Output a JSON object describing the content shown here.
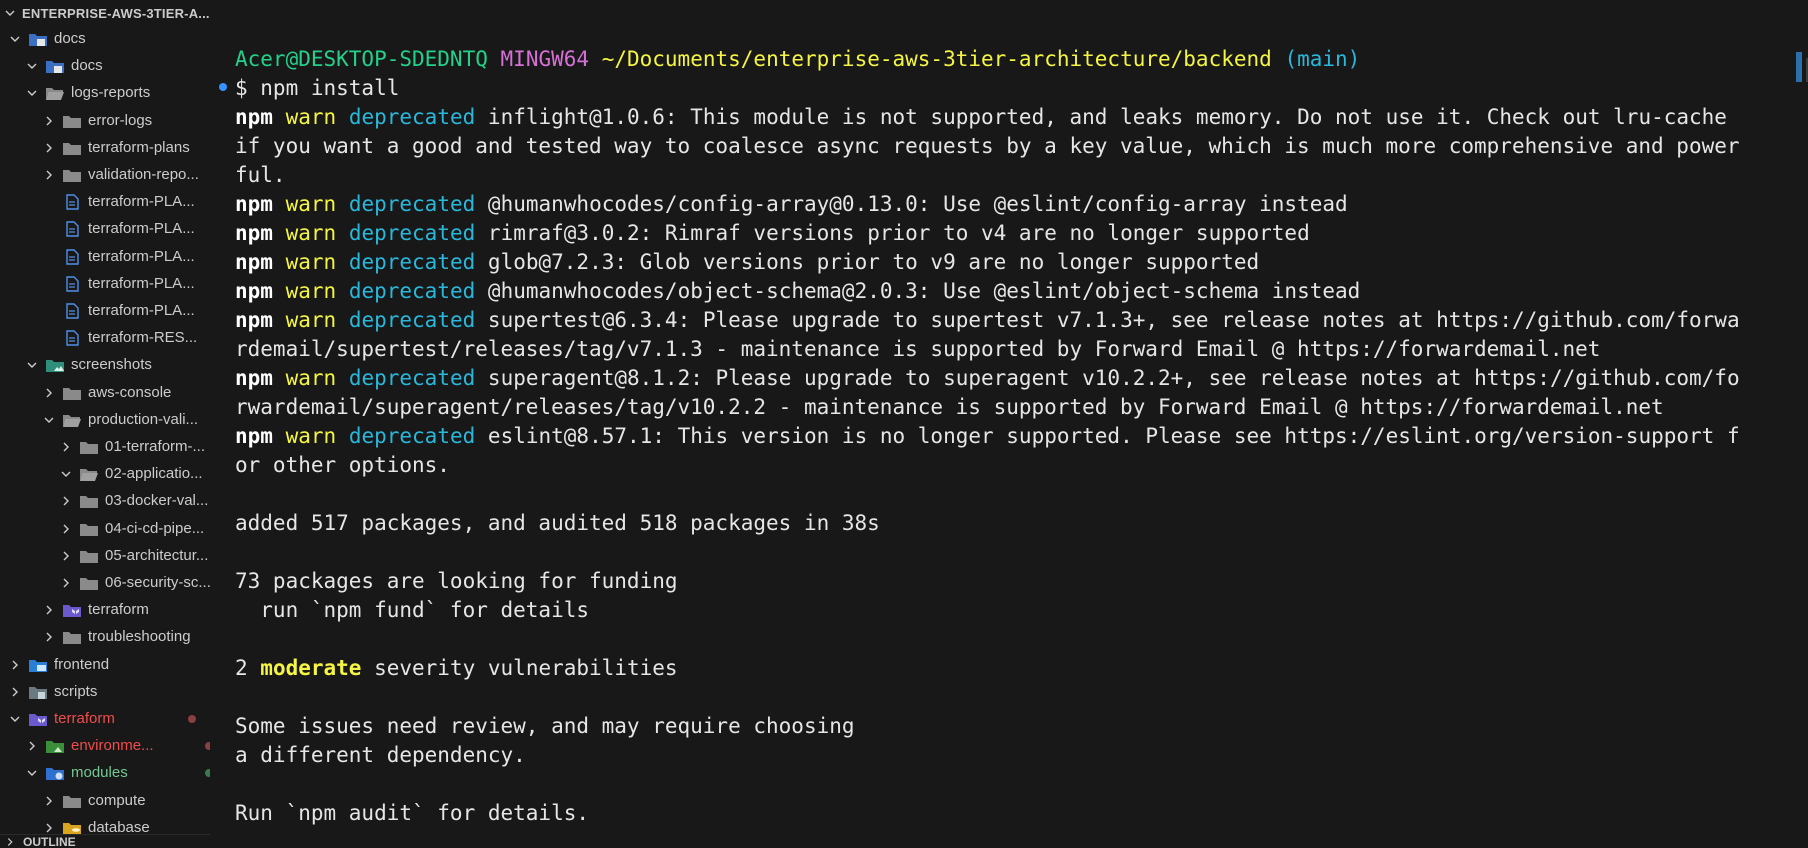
{
  "explorer": {
    "root_title": "ENTERPRISE-AWS-3TIER-A...",
    "outline_label": "OUTLINE",
    "items": [
      {
        "label": "docs",
        "depth": 1,
        "expanded": true,
        "icon": "docs-folder-icon",
        "color": "#cccccc"
      },
      {
        "label": "docs",
        "depth": 2,
        "expanded": true,
        "icon": "docs-folder-icon",
        "color": "#cccccc"
      },
      {
        "label": "logs-reports",
        "depth": 2,
        "expanded": true,
        "icon": "folder-open-icon",
        "color": "#cccccc"
      },
      {
        "label": "error-logs",
        "depth": 3,
        "expanded": false,
        "icon": "folder-icon",
        "color": "#cccccc"
      },
      {
        "label": "terraform-plans",
        "depth": 3,
        "expanded": false,
        "icon": "folder-icon",
        "color": "#cccccc"
      },
      {
        "label": "validation-repo...",
        "depth": 3,
        "expanded": false,
        "icon": "folder-icon",
        "color": "#cccccc"
      },
      {
        "label": "terraform-PLA...",
        "depth": 3,
        "file": true,
        "icon": "file-icon",
        "color": "#cccccc"
      },
      {
        "label": "terraform-PLA...",
        "depth": 3,
        "file": true,
        "icon": "file-icon",
        "color": "#cccccc"
      },
      {
        "label": "terraform-PLA...",
        "depth": 3,
        "file": true,
        "icon": "file-icon",
        "color": "#cccccc"
      },
      {
        "label": "terraform-PLA...",
        "depth": 3,
        "file": true,
        "icon": "file-icon",
        "color": "#cccccc"
      },
      {
        "label": "terraform-PLA...",
        "depth": 3,
        "file": true,
        "icon": "file-icon",
        "color": "#cccccc"
      },
      {
        "label": "terraform-RES...",
        "depth": 3,
        "file": true,
        "icon": "file-icon",
        "color": "#cccccc"
      },
      {
        "label": "screenshots",
        "depth": 2,
        "expanded": true,
        "icon": "images-folder-icon",
        "color": "#cccccc"
      },
      {
        "label": "aws-console",
        "depth": 3,
        "expanded": false,
        "icon": "folder-icon",
        "color": "#cccccc"
      },
      {
        "label": "production-vali...",
        "depth": 3,
        "expanded": true,
        "icon": "folder-open-icon",
        "color": "#cccccc"
      },
      {
        "label": "01-terraform-...",
        "depth": 4,
        "expanded": false,
        "icon": "folder-icon",
        "color": "#cccccc"
      },
      {
        "label": "02-applicatio...",
        "depth": 4,
        "expanded": true,
        "icon": "folder-open-icon",
        "color": "#cccccc"
      },
      {
        "label": "03-docker-val...",
        "depth": 4,
        "expanded": false,
        "icon": "folder-icon",
        "color": "#cccccc"
      },
      {
        "label": "04-ci-cd-pipe...",
        "depth": 4,
        "expanded": false,
        "icon": "folder-icon",
        "color": "#cccccc"
      },
      {
        "label": "05-architectur...",
        "depth": 4,
        "expanded": false,
        "icon": "folder-icon",
        "color": "#cccccc"
      },
      {
        "label": "06-security-sc...",
        "depth": 4,
        "expanded": false,
        "icon": "folder-icon",
        "color": "#cccccc"
      },
      {
        "label": "terraform",
        "depth": 3,
        "expanded": false,
        "icon": "terraform-folder-icon",
        "color": "#cccccc"
      },
      {
        "label": "troubleshooting",
        "depth": 3,
        "expanded": false,
        "icon": "folder-icon",
        "color": "#cccccc"
      },
      {
        "label": "frontend",
        "depth": 1,
        "expanded": false,
        "icon": "frontend-folder-icon",
        "color": "#cccccc"
      },
      {
        "label": "scripts",
        "depth": 1,
        "expanded": false,
        "icon": "scripts-folder-icon",
        "color": "#cccccc"
      },
      {
        "label": "terraform",
        "depth": 1,
        "expanded": true,
        "icon": "terraform-folder-icon",
        "color": "#f14c4c",
        "dot": "#8a4040"
      },
      {
        "label": "environme...",
        "depth": 2,
        "expanded": false,
        "icon": "environment-folder-icon",
        "color": "#f14c4c",
        "dot": "#8a4040"
      },
      {
        "label": "modules",
        "depth": 2,
        "expanded": true,
        "icon": "modules-folder-icon",
        "color": "#73c991",
        "dot": "#3a7a4c"
      },
      {
        "label": "compute",
        "depth": 3,
        "expanded": false,
        "icon": "folder-icon",
        "color": "#cccccc"
      },
      {
        "label": "database",
        "depth": 3,
        "expanded": false,
        "icon": "database-folder-icon",
        "color": "#cccccc"
      }
    ]
  },
  "terminal": {
    "prompt": {
      "user": "Acer@DESKTOP-SDEDNTQ",
      "shell": "MINGW64",
      "path": "~/Documents/enterprise-aws-3tier-architecture/backend",
      "branch": "(main)"
    },
    "command": "$ npm install",
    "warn_lines": [
      [
        "inflight@1.0.6: This module is not supported, and leaks memory. Do not use it. Check out lru-cache",
        "if you want a good and tested way to coalesce async requests by a key value, which is much more comprehensive and power",
        "ful."
      ],
      [
        "@humanwhocodes/config-array@0.13.0: Use @eslint/config-array instead"
      ],
      [
        "rimraf@3.0.2: Rimraf versions prior to v4 are no longer supported"
      ],
      [
        "glob@7.2.3: Glob versions prior to v9 are no longer supported"
      ],
      [
        "@humanwhocodes/object-schema@2.0.3: Use @eslint/object-schema instead"
      ],
      [
        "supertest@6.3.4: Please upgrade to supertest v7.1.3+, see release notes at https://github.com/forwa",
        "rdemail/supertest/releases/tag/v7.1.3 - maintenance is supported by Forward Email @ https://forwardemail.net"
      ],
      [
        "superagent@8.1.2: Please upgrade to superagent v10.2.2+, see release notes at https://github.com/fo",
        "rwardemail/superagent/releases/tag/v10.2.2 - maintenance is supported by Forward Email @ https://forwardemail.net"
      ],
      [
        "eslint@8.57.1: This version is no longer supported. Please see https://eslint.org/version-support f",
        "or other options."
      ]
    ],
    "npm_word": "npm",
    "warn_word": "warn",
    "deprecated_word": "deprecated",
    "added_line": "added 517 packages, and audited 518 packages in 38s",
    "funding_line": "73 packages are looking for funding",
    "fund_hint": "  run `npm fund` for details",
    "vuln_prefix": "2 ",
    "vuln_severity": "moderate",
    "vuln_suffix": " severity vulnerabilities",
    "review_line1": "Some issues need review, and may require choosing",
    "review_line2": "a different dependency.",
    "audit_line": "Run `npm audit` for details."
  }
}
